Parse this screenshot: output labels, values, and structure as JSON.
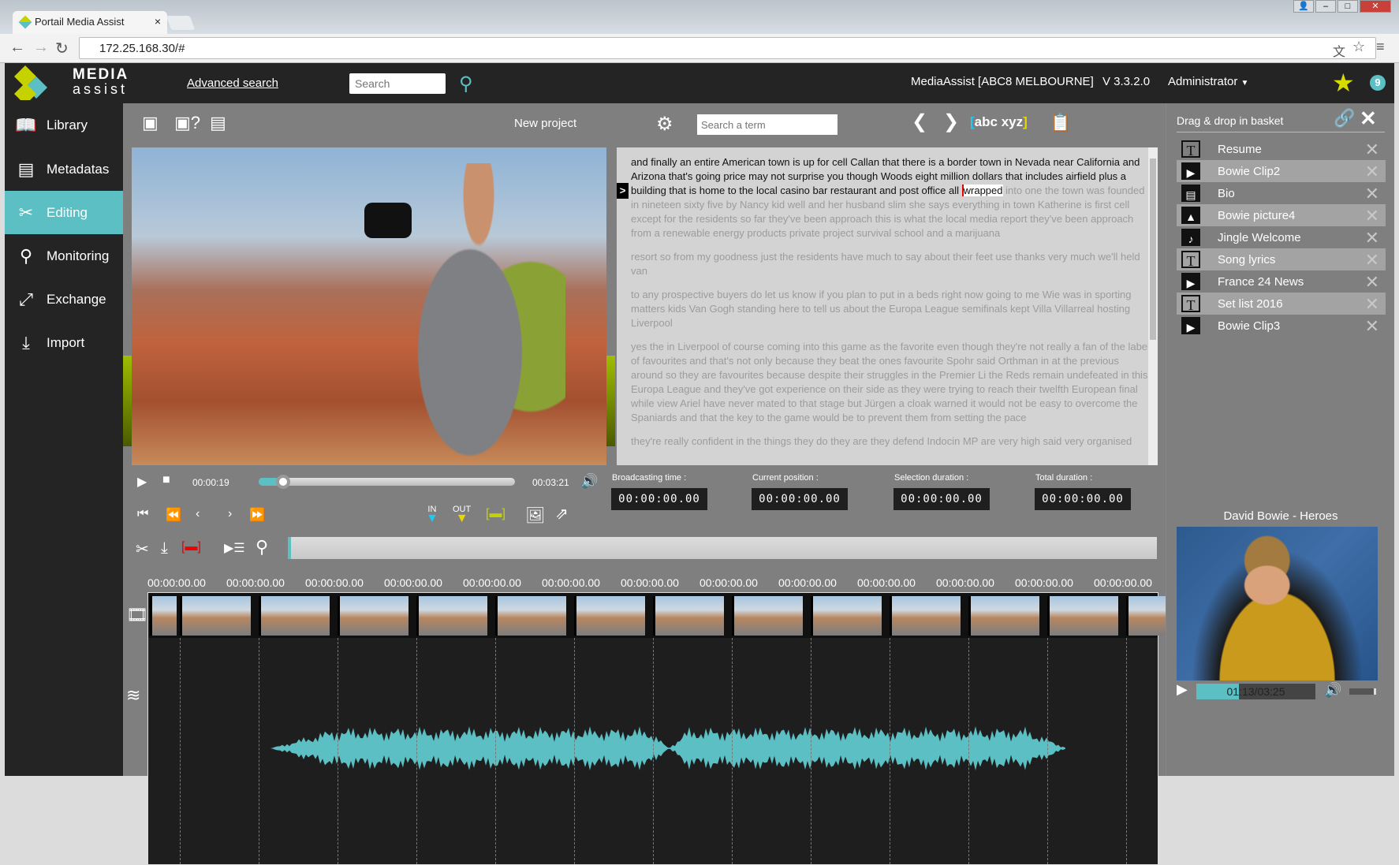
{
  "browser": {
    "tab_title": "Portail Media Assist",
    "url": "172.25.168.30/#"
  },
  "header": {
    "logo_line1": "MEDIA",
    "logo_line2": "assist",
    "advanced_search": "Advanced search",
    "search_placeholder": "Search",
    "instance": "MediaAssist [ABC8 MELBOURNE]",
    "version": "V 3.3.2.0",
    "user": "Administrator",
    "badge_count": "9"
  },
  "sidebar": {
    "items": [
      {
        "label": "Library",
        "icon": "book-icon"
      },
      {
        "label": "Metadatas",
        "icon": "document-icon"
      },
      {
        "label": "Editing",
        "icon": "scissors-icon",
        "active": true
      },
      {
        "label": "Monitoring",
        "icon": "magnifier-icon"
      },
      {
        "label": "Exchange",
        "icon": "link-arrows-icon"
      },
      {
        "label": "Import",
        "icon": "import-icon"
      }
    ]
  },
  "toolbar": {
    "project_name": "New project",
    "term_placeholder": "Search a term",
    "abc": "abc",
    "xyz": "xyz"
  },
  "transcript": {
    "read": "and finally an entire American town is up for cell Callan that there is a border town in Nevada near California and Arizona that's going price may not surprise you though Woods eight million dollars that includes airfield plus a building that is home to the local casino bar restaurant and post office all ",
    "current": "wrapped",
    "rest": " into one the town was founded in nineteen sixty five by Nancy kid well and her husband slim she says everything in town Katherine is first cell except for the residents so far they've been approach this is what the local media report they've been approach from a renewable energy products private project survival school and a marijuana",
    "paragraphs": [
      "resort so from my goodness just the residents have much to say about their feet use thanks very much we'll held van",
      "to any prospective buyers do let us know if you plan to put in a beds right now going to me Wie was in sporting matters kids Van Gogh standing here to tell us about the Europa League semifinals kept Villa Villarreal hosting Liverpool",
      "yes the in Liverpool of course coming into this game as the favorite even though they're not really a fan of the label of favourites and that's not only because they beat the ones favourite Spohr said Orthman in at the previous around so they are favourites because despite their struggles in the Premier Li the Reds remain undefeated in this Europa League and they've got experience on their side as they were trying to reach their twelfth European final while view Ariel have never mated to that stage but Jürgen a cloak warned it would not be easy to overcome the Spaniards and that the key to the game would be to prevent them from setting the pace",
      "they're really confident in the things they do they are they defend Indocin MP are very high said very organised"
    ]
  },
  "player": {
    "current_time": "00:00:19",
    "total_time": "00:03:21",
    "progress": 0.095,
    "in_label": "IN",
    "out_label": "OUT"
  },
  "timecodes": [
    {
      "label": "Broadcasting time :",
      "value": "00:00:00.00"
    },
    {
      "label": "Current position :",
      "value": "00:00:00.00"
    },
    {
      "label": "Selection duration :",
      "value": "00:00:00.00"
    },
    {
      "label": "Total duration :",
      "value": "00:00:00.00"
    }
  ],
  "timeline": {
    "ticks": [
      "00:00:00.00",
      "00:00:00.00",
      "00:00:00.00",
      "00:00:00.00",
      "00:00:00.00",
      "00:00:00.00",
      "00:00:00.00",
      "00:00:00.00",
      "00:00:00.00",
      "00:00:00.00",
      "00:00:00.00",
      "00:00:00.00",
      "00:00:00.00"
    ]
  },
  "basket": {
    "title": "Drag & drop in basket",
    "items": [
      {
        "label": "Resume",
        "type": "text"
      },
      {
        "label": "Bowie Clip2",
        "type": "video"
      },
      {
        "label": "Bio",
        "type": "document"
      },
      {
        "label": "Bowie picture4",
        "type": "image"
      },
      {
        "label": "Jingle Welcome",
        "type": "audio"
      },
      {
        "label": "Song lyrics",
        "type": "text"
      },
      {
        "label": "France 24 News",
        "type": "video"
      },
      {
        "label": "Set list 2016",
        "type": "text"
      },
      {
        "label": "Bowie Clip3",
        "type": "video"
      }
    ]
  },
  "preview": {
    "title": "David Bowie - Heroes",
    "time": "01:13/03:25",
    "progress": 0.36
  },
  "colors": {
    "accent": "#5bbfc3",
    "brand_yellow": "#d6dc00",
    "in_marker": "#1ec8f0",
    "out_marker": "#e8d800"
  }
}
